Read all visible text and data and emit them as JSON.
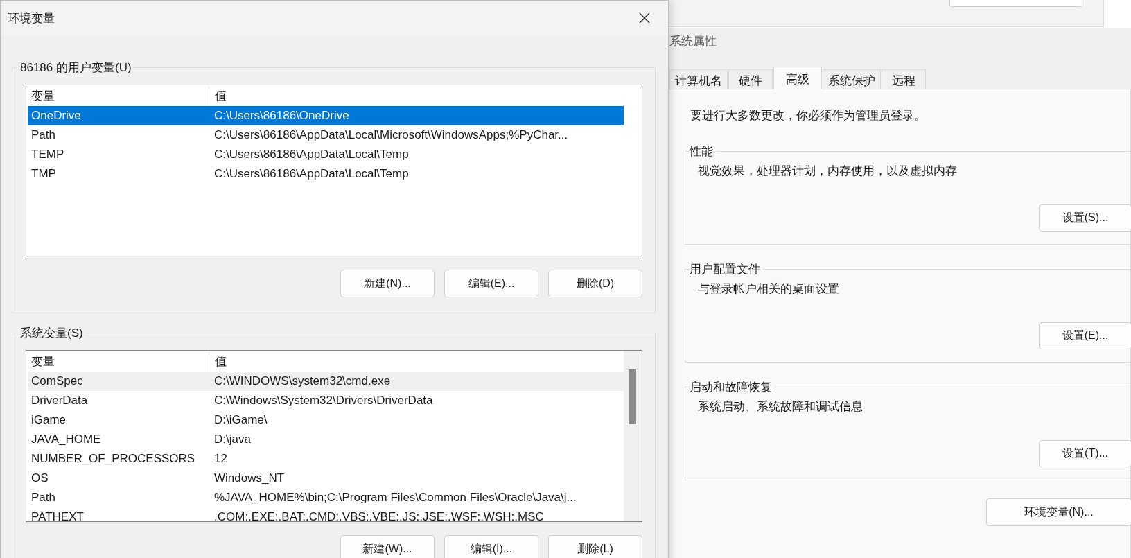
{
  "env_dialog": {
    "title": "环境变量",
    "lists": [
      {
        "label": "86186 的用户变量(U)",
        "focused": true,
        "scrollbar": false,
        "columns": [
          "变量",
          "值"
        ],
        "rows": [
          {
            "name": "OneDrive",
            "value": "C:\\Users\\86186\\OneDrive",
            "selected": true
          },
          {
            "name": "Path",
            "value": "C:\\Users\\86186\\AppData\\Local\\Microsoft\\WindowsApps;%PyChar...",
            "selected": false
          },
          {
            "name": "TEMP",
            "value": "C:\\Users\\86186\\AppData\\Local\\Temp",
            "selected": false
          },
          {
            "name": "TMP",
            "value": "C:\\Users\\86186\\AppData\\Local\\Temp",
            "selected": false
          }
        ],
        "buttons": [
          "新建(N)...",
          "编辑(E)...",
          "删除(D)"
        ]
      },
      {
        "label": "系统变量(S)",
        "focused": false,
        "scrollbar": true,
        "columns": [
          "变量",
          "值"
        ],
        "rows": [
          {
            "name": "ComSpec",
            "value": "C:\\WINDOWS\\system32\\cmd.exe",
            "selected": true
          },
          {
            "name": "DriverData",
            "value": "C:\\Windows\\System32\\Drivers\\DriverData",
            "selected": false
          },
          {
            "name": "iGame",
            "value": "D:\\iGame\\",
            "selected": false
          },
          {
            "name": "JAVA_HOME",
            "value": "D:\\java",
            "selected": false
          },
          {
            "name": "NUMBER_OF_PROCESSORS",
            "value": "12",
            "selected": false
          },
          {
            "name": "OS",
            "value": "Windows_NT",
            "selected": false
          },
          {
            "name": "Path",
            "value": "%JAVA_HOME%\\bin;C:\\Program Files\\Common Files\\Oracle\\Java\\j...",
            "selected": false
          },
          {
            "name": "PATHEXT",
            "value": ".COM;.EXE;.BAT;.CMD;.VBS;.VBE;.JS;.JSE;.WSF;.WSH;.MSC",
            "selected": false
          }
        ],
        "buttons": [
          "新建(W)...",
          "编辑(I)...",
          "删除(L)"
        ]
      }
    ]
  },
  "system_properties": {
    "title": "系统属性",
    "tabs": [
      {
        "label": "计算机名",
        "selected": false
      },
      {
        "label": "硬件",
        "selected": false
      },
      {
        "label": "高级",
        "selected": true
      },
      {
        "label": "系统保护",
        "selected": false
      },
      {
        "label": "远程",
        "selected": false
      }
    ],
    "notice": "要进行大多数更改，你必须作为管理员登录。",
    "groups": [
      {
        "label": "性能",
        "description": "视觉效果，处理器计划，内存使用，以及虚拟内存",
        "button": "设置(S)..."
      },
      {
        "label": "用户配置文件",
        "description": "与登录帐户相关的桌面设置",
        "button": "设置(E)..."
      },
      {
        "label": "启动和故障恢复",
        "description": "系统启动、系统故障和调试信息",
        "button": "设置(T)..."
      }
    ],
    "env_button": "环境变量(N)..."
  }
}
